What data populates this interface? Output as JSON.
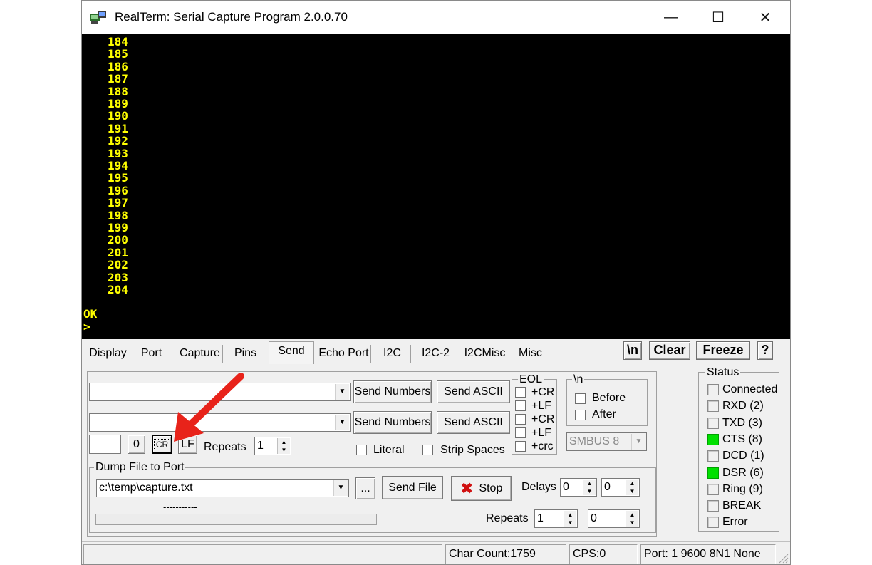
{
  "window": {
    "title": "RealTerm: Serial Capture Program 2.0.0.70",
    "minimize": "—",
    "maximize": "☐",
    "close": "✕"
  },
  "terminal": {
    "lines": [
      "184",
      "185",
      "186",
      "187",
      "188",
      "189",
      "190",
      "191",
      "192",
      "193",
      "194",
      "195",
      "196",
      "197",
      "198",
      "199",
      "200",
      "201",
      "202",
      "203",
      "204"
    ],
    "ok": "OK",
    "prompt": ">"
  },
  "tabs": [
    "Display",
    "Port",
    "Capture",
    "Pins",
    "Send",
    "Echo Port",
    "I2C",
    "I2C-2",
    "I2CMisc",
    "Misc"
  ],
  "active_tab": "Send",
  "toolbar": {
    "newline": "\\n",
    "clear": "Clear",
    "freeze": "Freeze",
    "help": "?"
  },
  "send": {
    "row1_value": "",
    "row2_value": "",
    "send_numbers": "Send Numbers",
    "send_ascii": "Send ASCII",
    "eol_label": "EOL",
    "eol_options": [
      "+CR",
      "+LF",
      "+CR",
      "+LF",
      "+crc"
    ],
    "newline_group": "\\n",
    "before": "Before",
    "after": "After",
    "smbus": "SMBUS 8",
    "char_box": "",
    "zero_btn": "0",
    "cr_btn": "CR",
    "lf_btn": "LF",
    "repeats_label": "Repeats",
    "repeats_value": "1",
    "literal": "Literal",
    "strip_spaces": "Strip Spaces"
  },
  "dump": {
    "group": "Dump File to Port",
    "file": "c:\\temp\\capture.txt",
    "browse": "...",
    "send_file": "Send File",
    "stop": "Stop",
    "delays_label": "Delays",
    "delay1": "0",
    "delay2": "0",
    "progress_text": "-----------",
    "repeats_label": "Repeats",
    "repeats1": "1",
    "repeats2": "0"
  },
  "status": {
    "group": "Status",
    "items": [
      {
        "label": "Connected",
        "on": false
      },
      {
        "label": "RXD (2)",
        "on": false
      },
      {
        "label": "TXD (3)",
        "on": false
      },
      {
        "label": "CTS (8)",
        "on": true
      },
      {
        "label": "DCD (1)",
        "on": false
      },
      {
        "label": "DSR (6)",
        "on": true
      },
      {
        "label": "Ring (9)",
        "on": false
      },
      {
        "label": "BREAK",
        "on": false
      },
      {
        "label": "Error",
        "on": false
      }
    ],
    "on_color": "#00e000"
  },
  "statusbar": {
    "char_count": "Char Count:1759",
    "cps": "CPS:0",
    "port": "Port: 1 9600 8N1 None"
  },
  "colors": {
    "terminal_bg": "#000000",
    "terminal_text": "#ffff00",
    "arrow": "#e8231a"
  }
}
